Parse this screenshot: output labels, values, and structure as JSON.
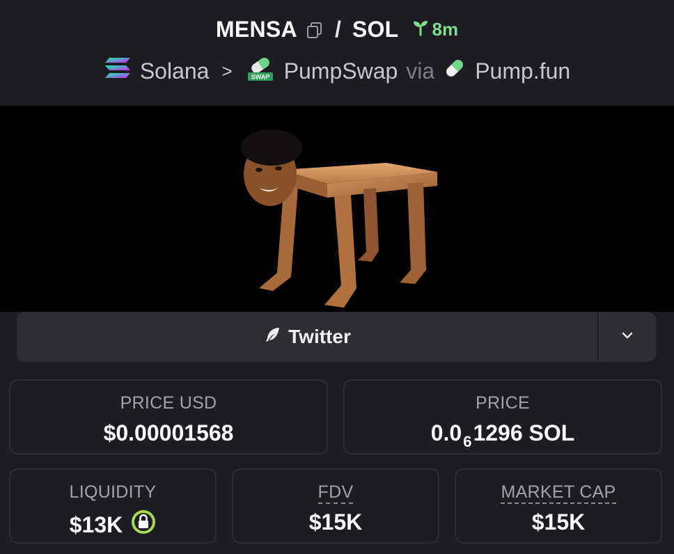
{
  "header": {
    "token_symbol": "MENSA",
    "separator": "/",
    "quote_symbol": "SOL",
    "age": "8m",
    "chain": "Solana",
    "chain_separator": ">",
    "dex": "PumpSwap",
    "dex_badge": "SWAP",
    "via_label": "via",
    "launchpad": "Pump.fun"
  },
  "socials": {
    "twitter_label": "Twitter"
  },
  "stats": {
    "price_usd_label": "PRICE USD",
    "price_usd_value": "$0.00001568",
    "price_label": "PRICE",
    "price_prefix": "0.0",
    "price_subscript": "6",
    "price_suffix": "1296 SOL",
    "liquidity_label": "LIQUIDITY",
    "liquidity_value": "$13K",
    "fdv_label": "FDV",
    "fdv_value": "$15K",
    "market_cap_label": "MARKET CAP",
    "market_cap_value": "$15K"
  },
  "colors": {
    "background": "#1c1c22",
    "card_border": "#2c2c33",
    "age_green": "#7ce08e",
    "lock_green": "#a6d94a"
  },
  "icons": {
    "copy": "copy-icon",
    "age": "sprout-icon",
    "chain": "solana-icon",
    "dex": "pumpswap-icon",
    "launchpad": "pill-icon",
    "twitter": "feather-icon",
    "more": "chevron-down-icon",
    "liquidity_lock": "lock-icon"
  }
}
